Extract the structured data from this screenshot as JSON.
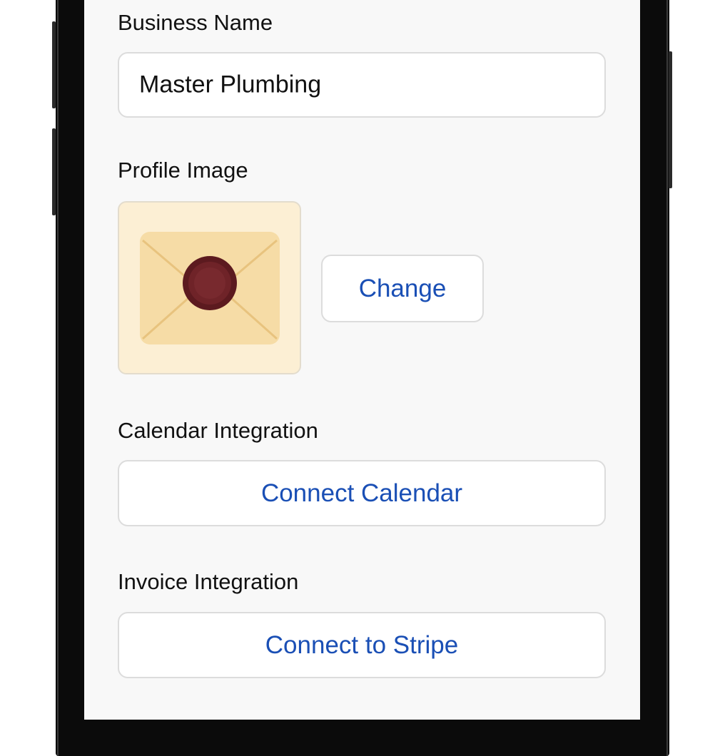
{
  "form": {
    "business_name": {
      "label": "Business Name",
      "value": "Master Plumbing"
    },
    "profile_image": {
      "label": "Profile Image",
      "image_icon": "envelope-wax-seal-icon",
      "change_label": "Change"
    },
    "calendar": {
      "label": "Calendar Integration",
      "button_label": "Connect Calendar"
    },
    "invoice": {
      "label": "Invoice Integration",
      "button_label": "Connect to Stripe"
    }
  },
  "colors": {
    "accent": "#1a4fb5",
    "screen_background": "#f8f8f8",
    "field_border": "#dcdcdc",
    "seal": "#6f2328",
    "envelope": "#f6dca6"
  }
}
